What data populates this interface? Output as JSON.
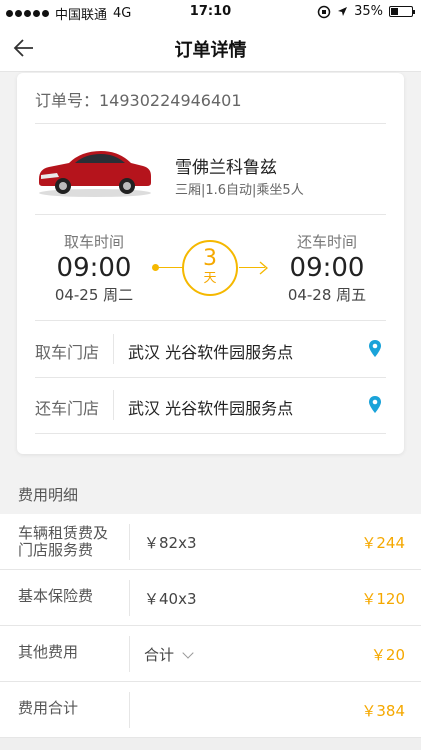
{
  "status_bar": {
    "carrier": "中国联通",
    "network": "4G",
    "time": "17:10",
    "battery": "35%"
  },
  "header": {
    "title": "订单详情"
  },
  "order": {
    "number_label": "订单号：14930224946401",
    "car_name": "雪佛兰科鲁兹",
    "car_spec": "三厢|1.6自动|乘坐5人",
    "pickup": {
      "label": "取车时间",
      "time": "09:00",
      "date": "04-25 周二"
    },
    "return": {
      "label": "还车时间",
      "time": "09:00",
      "date": "04-28 周五"
    },
    "duration": {
      "number": "3",
      "unit": "天"
    },
    "pickup_store": {
      "label": "取车门店",
      "name": "武汉 光谷软件园服务点"
    },
    "return_store": {
      "label": "还车门店",
      "name": "武汉 光谷软件园服务点"
    }
  },
  "fees": {
    "section_title": "费用明细",
    "rental": {
      "label_line1": "车辆租赁费及",
      "label_line2": "门店服务费",
      "calc": "￥82x3",
      "amount": "￥244"
    },
    "insurance": {
      "label": "基本保险费",
      "calc": "￥40x3",
      "amount": "￥120"
    },
    "other": {
      "label": "其他费用",
      "calc": "合计",
      "amount": "￥20"
    },
    "total": {
      "label": "费用合计",
      "amount": "￥384"
    }
  },
  "colors": {
    "accent": "#f5b800",
    "pin": "#1aa3d9"
  },
  "icons": {
    "back": "back-arrow-icon",
    "location": "location-pin-icon",
    "chevron": "chevron-down-icon"
  }
}
